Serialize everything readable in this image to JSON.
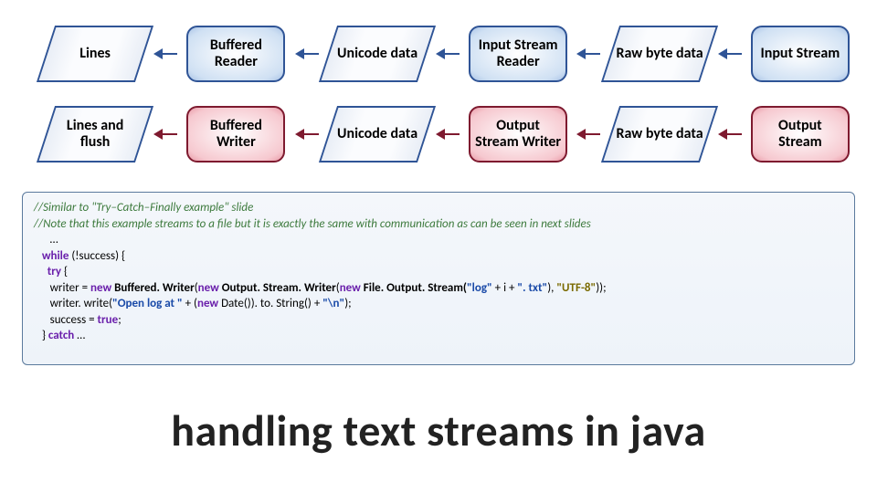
{
  "chart_data": {
    "type": "diagram",
    "title": "handling text streams in java",
    "flows": [
      {
        "direction": "left",
        "nodes": [
          {
            "kind": "parallelogram-blue",
            "label": "Lines"
          },
          {
            "kind": "roundrect-blue",
            "label": "Buffered Reader"
          },
          {
            "kind": "parallelogram-blue",
            "label": "Unicode data"
          },
          {
            "kind": "roundrect-blue",
            "label": "Input Stream Reader"
          },
          {
            "kind": "parallelogram-blue",
            "label": "Raw byte data"
          },
          {
            "kind": "roundrect-blue",
            "label": "Input Stream"
          }
        ]
      },
      {
        "direction": "left",
        "nodes": [
          {
            "kind": "parallelogram-blue",
            "label": "Lines and flush"
          },
          {
            "kind": "roundrect-red",
            "label": "Buffered Writer"
          },
          {
            "kind": "parallelogram-blue",
            "label": "Unicode data"
          },
          {
            "kind": "roundrect-red",
            "label": "Output Stream Writer"
          },
          {
            "kind": "parallelogram-blue",
            "label": "Raw byte data"
          },
          {
            "kind": "roundrect-red",
            "label": "Output Stream"
          }
        ]
      }
    ]
  },
  "code": {
    "c1": "//Similar to \"Try–Catch–Finally example\" slide",
    "c2": "//Note that this example streams to a file but it is exactly the same with communication as can be seen in next slides",
    "dots1": "…",
    "kw_while": "while",
    "cond": " (!success) {",
    "kw_try": "try",
    "brace_open": " {",
    "l3a": "      writer = ",
    "kw_new1": "new",
    "sp": " ",
    "cls_bw": "Buffered. Writer",
    "paren_new2": "(",
    "kw_new2": "new",
    "cls_osw": "Output. Stream. Writer",
    "paren_new3": "(",
    "kw_new3": "new",
    "cls_fos": "File. Output. Stream(",
    "str_log": "\"log\"",
    "plus_i": " + i + ",
    "str_txt": "\". txt\"",
    "close1": "), ",
    "str_utf": "\"UTF-8\"",
    "close2": "));",
    "l4a": "      writer. write(",
    "str_open": "\"Open log at \"",
    "l4b": " + (",
    "kw_new4": "new",
    "l4c": " Date()). to. String() + ",
    "str_nl": "\"\\n\"",
    "l4d": ");",
    "l5a": "      success = ",
    "kw_true": "true",
    "l5b": ";",
    "l6a": "   } ",
    "kw_catch": "catch",
    "dots2": " …"
  },
  "title": "handling text streams in java"
}
